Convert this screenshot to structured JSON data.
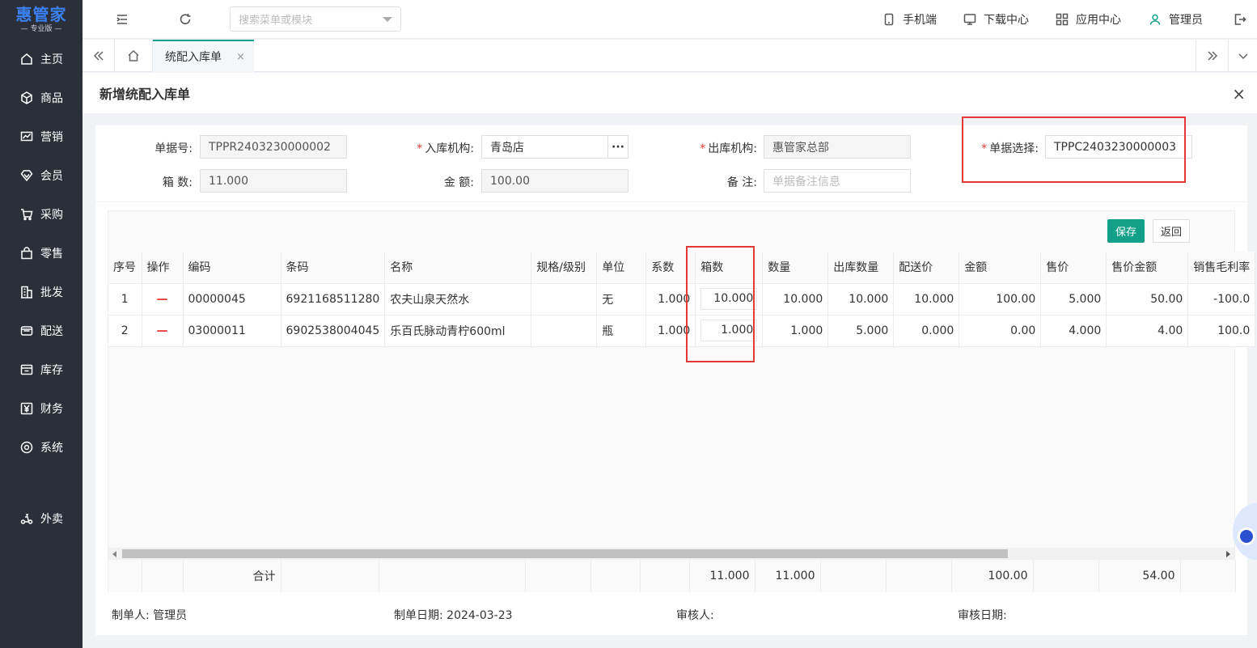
{
  "logo": {
    "main": "惠管家",
    "sub": "— 专业版 —"
  },
  "sidebar": {
    "items": [
      {
        "label": "主页",
        "icon": "home-icon"
      },
      {
        "label": "商品",
        "icon": "box-icon"
      },
      {
        "label": "营销",
        "icon": "chart-icon"
      },
      {
        "label": "会员",
        "icon": "diamond-icon"
      },
      {
        "label": "采购",
        "icon": "cart-icon"
      },
      {
        "label": "零售",
        "icon": "bag-icon"
      },
      {
        "label": "批发",
        "icon": "building-icon"
      },
      {
        "label": "配送",
        "icon": "truck-icon"
      },
      {
        "label": "库存",
        "icon": "stock-icon"
      },
      {
        "label": "财务",
        "icon": "yen-icon"
      },
      {
        "label": "系统",
        "icon": "settings-icon"
      },
      {
        "label": "外卖",
        "icon": "scooter-icon"
      }
    ]
  },
  "topbar": {
    "search_placeholder": "搜索菜单或模块",
    "mobile": "手机端",
    "download": "下载中心",
    "apps": "应用中心",
    "user": "管理员"
  },
  "tabs": {
    "active": "统配入库单",
    "close": "×"
  },
  "panel": {
    "title": "新增统配入库单",
    "close": "×"
  },
  "form": {
    "doc_no_label": "单据号:",
    "doc_no": "TPPR2403230000002",
    "in_org_label": "入库机构:",
    "in_org": "青岛店",
    "out_org_label": "出库机构:",
    "out_org": "惠管家总部",
    "doc_select_label": "单据选择:",
    "doc_select": "TPPC2403230000003",
    "boxes_label": "箱 数:",
    "boxes": "11.000",
    "amount_label": "金 额:",
    "amount": "100.00",
    "remark_label": "备 注:",
    "remark_placeholder": "单据备注信息",
    "required_mark": "*",
    "more": "···"
  },
  "buttons": {
    "save": "保存",
    "back": "返回"
  },
  "table": {
    "headers": [
      "序号",
      "操作",
      "编码",
      "条码",
      "名称",
      "规格/级别",
      "单位",
      "系数",
      "箱数",
      "数量",
      "出库数量",
      "配送价",
      "金额",
      "售价",
      "售价金额",
      "销售毛利率"
    ],
    "rows": [
      {
        "no": "1",
        "op": "—",
        "code": "00000045",
        "barcode": "6921168511280",
        "name": "农夫山泉天然水",
        "spec": "",
        "unit": "无",
        "factor": "1.000",
        "boxes": "10.000",
        "qty": "10.000",
        "out_qty": "10.000",
        "price": "10.000",
        "amount": "100.00",
        "sale_price": "5.000",
        "sale_amount": "50.00",
        "margin": "-100.0"
      },
      {
        "no": "2",
        "op": "—",
        "code": "03000011",
        "barcode": "6902538004045",
        "name": "乐百氏脉动青柠600ml",
        "spec": "",
        "unit": "瓶",
        "factor": "1.000",
        "boxes": "1.000",
        "qty": "1.000",
        "out_qty": "5.000",
        "price": "0.000",
        "amount": "0.00",
        "sale_price": "4.000",
        "sale_amount": "4.00",
        "margin": "100.0"
      }
    ],
    "totals": {
      "label": "合计",
      "boxes": "11.000",
      "qty": "11.000",
      "amount": "100.00",
      "sale_amount": "54.00"
    }
  },
  "footer": {
    "maker_label": "制单人:",
    "maker": "管理员",
    "date_label": "制单日期:",
    "date": "2024-03-23",
    "auditor_label": "审核人:",
    "audit_date_label": "审核日期:"
  },
  "colors": {
    "accent": "#13a089",
    "highlight": "#e53935",
    "sidebar": "#2b2f3a"
  }
}
